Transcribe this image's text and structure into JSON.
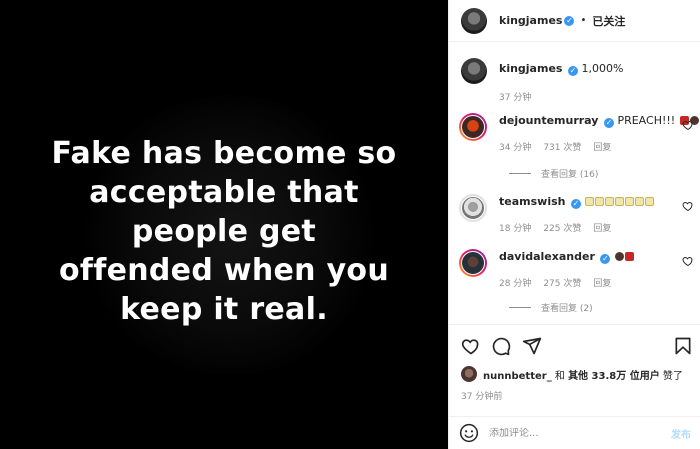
{
  "image": {
    "quote_lines": [
      "Fake has become so",
      "acceptable that",
      "people get",
      "offended when you",
      "keep it real."
    ]
  },
  "header": {
    "username": "kingjames",
    "separator": "•",
    "follow_status": "已关注",
    "more_icon": "more-horizontal-icon"
  },
  "caption": {
    "username": "kingjames",
    "text": "1,000%",
    "time": "37 分钟"
  },
  "comments": [
    {
      "username": "dejountemurray",
      "text": "PREACH!!!",
      "emoji": [
        "red-100-emoji",
        "fist-emoji"
      ],
      "time": "34 分钟",
      "likes": "731 次赞",
      "reply_label": "回复",
      "view_replies": "查看回复 (16)"
    },
    {
      "username": "teamswish",
      "text": "",
      "emoji": [
        "cake-emoji",
        "cake-emoji",
        "cake-emoji",
        "cake-emoji",
        "cake-emoji",
        "cake-emoji",
        "cake-emoji"
      ],
      "time": "18 分钟",
      "likes": "225 次赞",
      "reply_label": "回复",
      "view_replies": ""
    },
    {
      "username": "davidalexander",
      "text": "",
      "emoji": [
        "fist-emoji",
        "red-100-emoji"
      ],
      "time": "28 分钟",
      "likes": "275 次赞",
      "reply_label": "回复",
      "view_replies": "查看回复 (2)"
    }
  ],
  "actions": {
    "like_icon": "heart-icon",
    "comment_icon": "comment-icon",
    "share_icon": "send-icon",
    "save_icon": "bookmark-icon"
  },
  "likes_summary": {
    "first_user": "nunnbetter_",
    "connector": " 和 ",
    "others": "其他 33.8万 位用户",
    "suffix": " 赞了"
  },
  "post_time": "37 分钟前",
  "composer": {
    "placeholder": "添加评论...",
    "post_label": "发布"
  },
  "colors": {
    "verified": "#3897f0",
    "post_button": "#b3dbff",
    "muted": "#8e8e8e"
  }
}
